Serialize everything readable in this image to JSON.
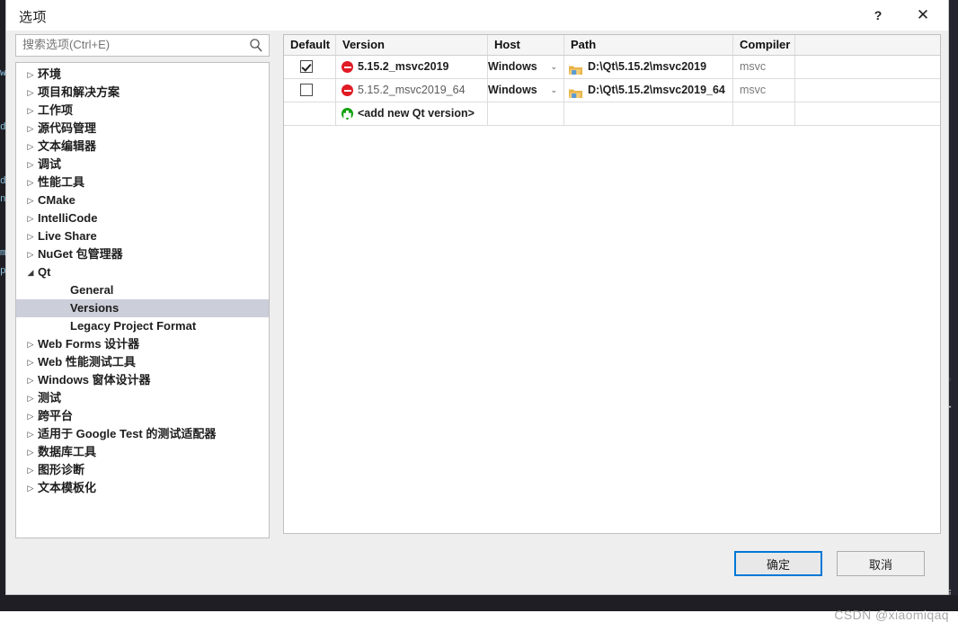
{
  "window": {
    "title": "选项",
    "help_label": "?",
    "close_label": "✕"
  },
  "search": {
    "placeholder": "搜索选项(Ctrl+E)",
    "value": "",
    "icon": "search-icon"
  },
  "tree": {
    "selected": "Versions",
    "collapsed_glyph": "▷",
    "expanded_glyph": "◢",
    "items": [
      {
        "label": "环境",
        "level": 1,
        "expandable": true,
        "expanded": false
      },
      {
        "label": "项目和解决方案",
        "level": 1,
        "expandable": true,
        "expanded": false
      },
      {
        "label": "工作项",
        "level": 1,
        "expandable": true,
        "expanded": false
      },
      {
        "label": "源代码管理",
        "level": 1,
        "expandable": true,
        "expanded": false
      },
      {
        "label": "文本编辑器",
        "level": 1,
        "expandable": true,
        "expanded": false
      },
      {
        "label": "调试",
        "level": 1,
        "expandable": true,
        "expanded": false
      },
      {
        "label": "性能工具",
        "level": 1,
        "expandable": true,
        "expanded": false
      },
      {
        "label": "CMake",
        "level": 1,
        "expandable": true,
        "expanded": false
      },
      {
        "label": "IntelliCode",
        "level": 1,
        "expandable": true,
        "expanded": false
      },
      {
        "label": "Live Share",
        "level": 1,
        "expandable": true,
        "expanded": false
      },
      {
        "label": "NuGet 包管理器",
        "level": 1,
        "expandable": true,
        "expanded": false
      },
      {
        "label": "Qt",
        "level": 1,
        "expandable": true,
        "expanded": true
      },
      {
        "label": "General",
        "level": 2,
        "expandable": false,
        "expanded": false
      },
      {
        "label": "Versions",
        "level": 2,
        "expandable": false,
        "expanded": false
      },
      {
        "label": "Legacy Project Format",
        "level": 2,
        "expandable": false,
        "expanded": false
      },
      {
        "label": "Web Forms 设计器",
        "level": 1,
        "expandable": true,
        "expanded": false
      },
      {
        "label": "Web 性能测试工具",
        "level": 1,
        "expandable": true,
        "expanded": false
      },
      {
        "label": "Windows 窗体设计器",
        "level": 1,
        "expandable": true,
        "expanded": false
      },
      {
        "label": "测试",
        "level": 1,
        "expandable": true,
        "expanded": false
      },
      {
        "label": "跨平台",
        "level": 1,
        "expandable": true,
        "expanded": false
      },
      {
        "label": "适用于 Google Test 的测试适配器",
        "level": 1,
        "expandable": true,
        "expanded": false
      },
      {
        "label": "数据库工具",
        "level": 1,
        "expandable": true,
        "expanded": false
      },
      {
        "label": "图形诊断",
        "level": 1,
        "expandable": true,
        "expanded": false
      },
      {
        "label": "文本模板化",
        "level": 1,
        "expandable": true,
        "expanded": false
      }
    ]
  },
  "grid": {
    "columns": [
      "Default",
      "Version",
      "Host",
      "Path",
      "Compiler",
      ""
    ],
    "rows": [
      {
        "default_checked": true,
        "version": "5.15.2_msvc2019",
        "version_icon": "error-circle-icon",
        "version_bold": true,
        "host": "Windows",
        "host_caret": "⌄",
        "path": "D:\\Qt\\5.15.2\\msvc2019",
        "path_icon": "folder-icon",
        "compiler": "msvc",
        "extra": ""
      },
      {
        "default_checked": false,
        "version": "5.15.2_msvc2019_64",
        "version_icon": "error-circle-icon",
        "version_bold": false,
        "host": "Windows",
        "host_caret": "⌄",
        "path": "D:\\Qt\\5.15.2\\msvc2019_64",
        "path_icon": "folder-icon",
        "compiler": "msvc",
        "extra": ""
      }
    ],
    "add_row": {
      "label": "<add new Qt version>",
      "icon": "add-circle-icon"
    }
  },
  "footer": {
    "ok_label": "确定",
    "cancel_label": "取消"
  },
  "watermark": {
    "text": "CSDN @xiaomiqaq"
  },
  "backdrop": {
    "left_code": "\nw\n\n\nd\n\n\nd\nn\n\n\nm\np",
    "right_marks": [
      "◌",
      "┳"
    ]
  },
  "colors": {
    "accent": "#0078d7",
    "selection": "#ccced9",
    "error": "#e01b24",
    "add": "#13a10e",
    "folder": "#e8b44a"
  }
}
